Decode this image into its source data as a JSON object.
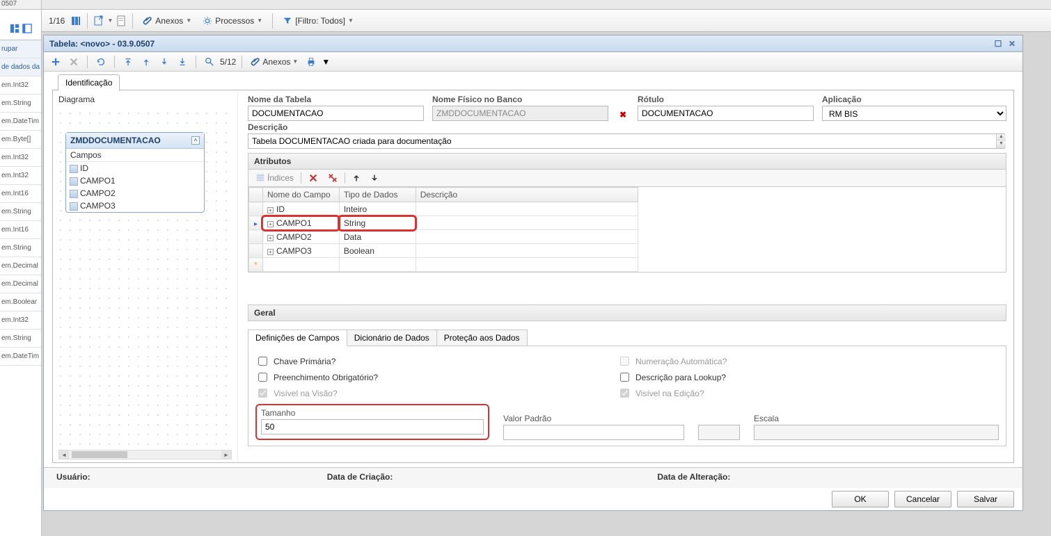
{
  "top_toolbar": {
    "page": "1/16",
    "anexos": "Anexos",
    "processos": "Processos",
    "filtro": "[Filtro: Todos]"
  },
  "left_panel": {
    "tab": "0507",
    "group": "rupar",
    "datahdr": "de dados da",
    "types": [
      "em.Int32",
      "em.String",
      "em.DateTim",
      "em.Byte[]",
      "em.Int32",
      "em.Int32",
      "em.Int16",
      "em.String",
      "em.Int16",
      "em.String",
      "em.Decimal",
      "em.Decimal",
      "em.Boolear",
      "em.Int32",
      "em.String",
      "em.DateTim"
    ]
  },
  "dialog": {
    "title": "Tabela: <novo> - 03.9.0507",
    "toolbar_page": "5/12",
    "anexos": "Anexos",
    "tab_ident": "Identificação",
    "diagram": {
      "label": "Diagrama",
      "entity_name": "ZMDDOCUMENTACAO",
      "campos_label": "Campos",
      "fields": [
        "ID",
        "CAMPO1",
        "CAMPO2",
        "CAMPO3"
      ]
    },
    "fields": {
      "nome_tabela_label": "Nome da Tabela",
      "nome_tabela": "DOCUMENTACAO",
      "nome_fisico_label": "Nome Físico no Banco",
      "nome_fisico": "ZMDDOCUMENTACAO",
      "rotulo_label": "Rótulo",
      "rotulo": "DOCUMENTACAO",
      "aplicacao_label": "Aplicação",
      "aplicacao": "RM BIS",
      "descricao_label": "Descrição",
      "descricao": "Tabela DOCUMENTACAO criada para documentação"
    },
    "atributos": {
      "header": "Atributos",
      "indices": "Índices",
      "cols": {
        "nome": "Nome do Campo",
        "tipo": "Tipo de Dados",
        "desc": "Descrição"
      },
      "rows": [
        {
          "nome": "ID",
          "tipo": "Inteiro",
          "desc": ""
        },
        {
          "nome": "CAMPO1",
          "tipo": "String",
          "desc": ""
        },
        {
          "nome": "CAMPO2",
          "tipo": "Data",
          "desc": ""
        },
        {
          "nome": "CAMPO3",
          "tipo": "Boolean",
          "desc": ""
        }
      ]
    },
    "geral": {
      "header": "Geral",
      "tabs": {
        "def": "Definições de Campos",
        "dic": "Dicionário de Dados",
        "prot": "Proteção aos Dados"
      },
      "checks": {
        "chave": "Chave Primária?",
        "num_auto": "Numeração Automática?",
        "preench": "Preenchimento Obrigatório?",
        "desc_lookup": "Descrição para Lookup?",
        "vis_visao": "Visível na Visão?",
        "vis_edicao": "Visível na Edição?"
      },
      "tamanho_label": "Tamanho",
      "tamanho": "50",
      "valor_padrao_label": "Valor Padrão",
      "valor_padrao": "",
      "escala_label": "Escala",
      "escala": ""
    },
    "footer": {
      "usuario": "Usuário:",
      "dcriacao": "Data de Criação:",
      "dalteracao": "Data de Alteração:"
    },
    "buttons": {
      "ok": "OK",
      "cancelar": "Cancelar",
      "salvar": "Salvar"
    }
  },
  "colors": {
    "accent": "#3d6ea5",
    "highlight": "#d73333"
  }
}
